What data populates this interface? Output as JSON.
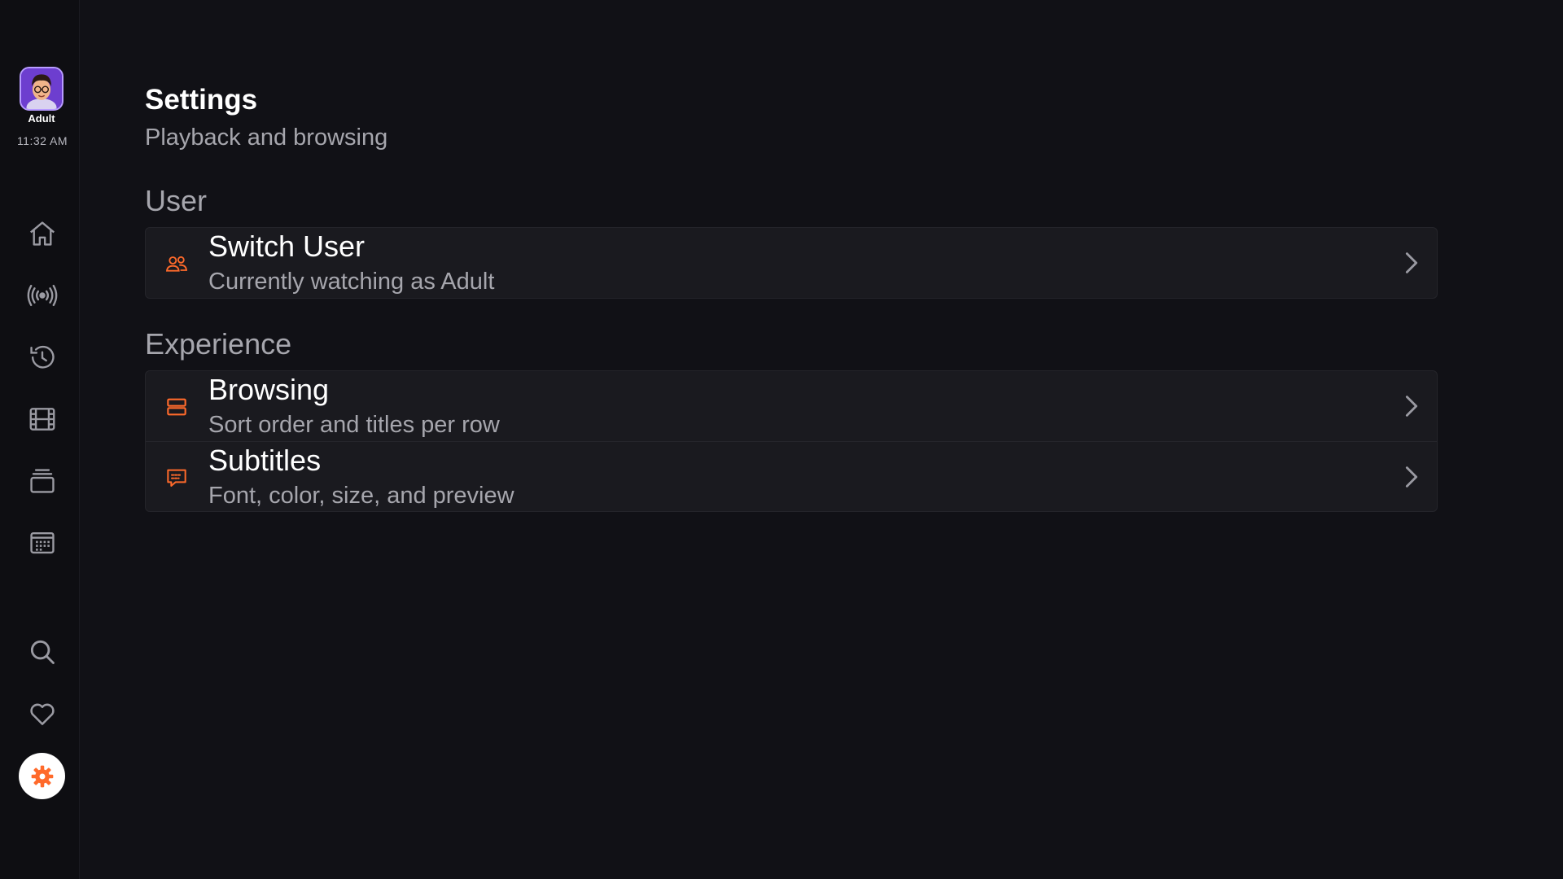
{
  "sidebar": {
    "profile_name": "Adult",
    "clock": "11:32 AM",
    "nav": [
      {
        "icon": "home-icon"
      },
      {
        "icon": "live-broadcast-icon"
      },
      {
        "icon": "history-icon"
      },
      {
        "icon": "film-icon"
      },
      {
        "icon": "collections-icon"
      },
      {
        "icon": "calendar-icon"
      },
      {
        "icon": "search-icon"
      },
      {
        "icon": "heart-icon"
      },
      {
        "icon": "gear-icon",
        "active": true
      }
    ]
  },
  "header": {
    "title": "Settings",
    "subtitle": "Playback and browsing"
  },
  "sections": [
    {
      "label": "User",
      "items": [
        {
          "icon": "users-icon",
          "title": "Switch User",
          "description": "Currently watching as Adult"
        }
      ]
    },
    {
      "label": "Experience",
      "items": [
        {
          "icon": "rows-icon",
          "title": "Browsing",
          "description": "Sort order and titles per row"
        },
        {
          "icon": "subtitles-icon",
          "title": "Subtitles",
          "description": "Font, color, size, and preview"
        }
      ]
    }
  ],
  "colors": {
    "background": "#111116",
    "accent": "#ff6a2b",
    "card": "#1a1a1f",
    "muted_text": "#a6a6ad"
  }
}
